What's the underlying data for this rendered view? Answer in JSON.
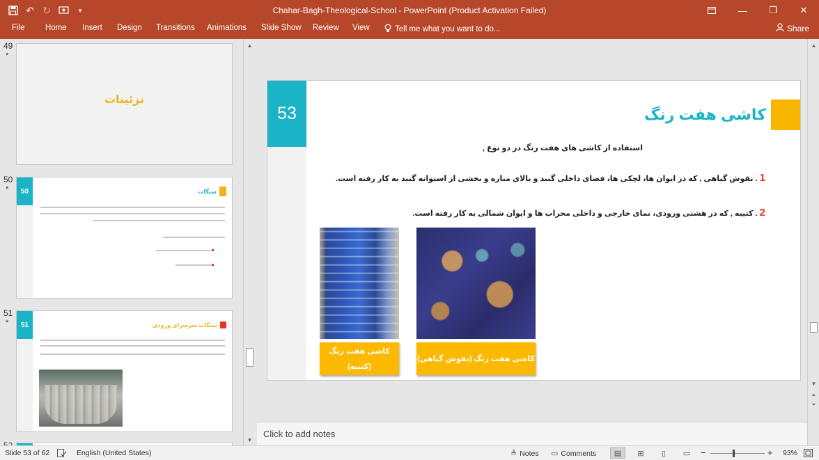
{
  "window": {
    "title": "Chahar-Bagh-Theological-School - PowerPoint (Product Activation Failed)",
    "qat_icons": [
      "save-icon",
      "undo-icon",
      "redo-icon",
      "presenter-icon",
      "customize-icon"
    ]
  },
  "ribbon": {
    "tabs": [
      "File",
      "Home",
      "Insert",
      "Design",
      "Transitions",
      "Animations",
      "Slide Show",
      "Review",
      "View"
    ],
    "tell_me": "Tell me what you want to do...",
    "share": "Share"
  },
  "thumbnails": [
    {
      "number": "49",
      "star": "*",
      "title": "تزئینات"
    },
    {
      "number": "50",
      "star": "*",
      "badge": "50",
      "title": "سنگاب"
    },
    {
      "number": "51",
      "star": "*",
      "badge": "51",
      "title": "سنگاب سرسرای ورودی"
    },
    {
      "number": "52"
    }
  ],
  "slide": {
    "number": "53",
    "title": "کاشی هفت رنگ",
    "intro": "استفاده از کاشی های هفت رنگ در دو نوع ,",
    "items": [
      {
        "num": "1",
        "text": ". نقوش گیاهی , که در ایوان ها، لچکی ها، فضای داخلی گنبد و بالای مناره و بخشی از استوانه گنبد به کار رفته است."
      },
      {
        "num": "2",
        "text": ". کتیبه , که در هشتی ورودی، نمای خارجی و داخلی محراب ها و ایوان شمالی به کار رفته است."
      }
    ],
    "captions": {
      "a_line1": "کاشی هفت رنگ",
      "a_line2": "(کتیبه)",
      "b": "کاشی هفت رنگ (نقوش گیاهی)"
    }
  },
  "notes": {
    "placeholder": "Click to add notes"
  },
  "status": {
    "slide_info": "Slide 53 of 62",
    "language": "English (United States)",
    "notes": "Notes",
    "comments": "Comments",
    "zoom": "93%"
  },
  "colors": {
    "ribbon": "#b7472a",
    "accent_teal": "#1bb4c6",
    "accent_yellow": "#f7b500",
    "accent_red": "#e8332a"
  }
}
